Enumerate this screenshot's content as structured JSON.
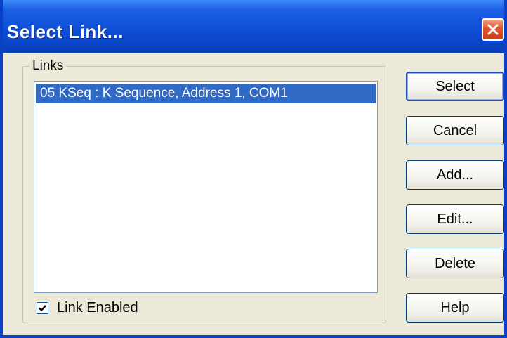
{
  "window": {
    "title": "Select Link...",
    "close_icon": "close-icon"
  },
  "links_group": {
    "label": "Links",
    "items": [
      {
        "label": "05 KSeq : K Sequence, Address 1, COM1",
        "selected": true
      }
    ]
  },
  "link_enabled": {
    "label": "Link Enabled",
    "checked": true
  },
  "buttons": {
    "select": "Select",
    "cancel": "Cancel",
    "add": "Add...",
    "edit": "Edit...",
    "delete": "Delete",
    "help": "Help"
  },
  "colors": {
    "title_bar": "#0e4fd6",
    "selection": "#316ac5",
    "dialog_bg": "#ece9d8",
    "close_button": "#e0522a"
  }
}
